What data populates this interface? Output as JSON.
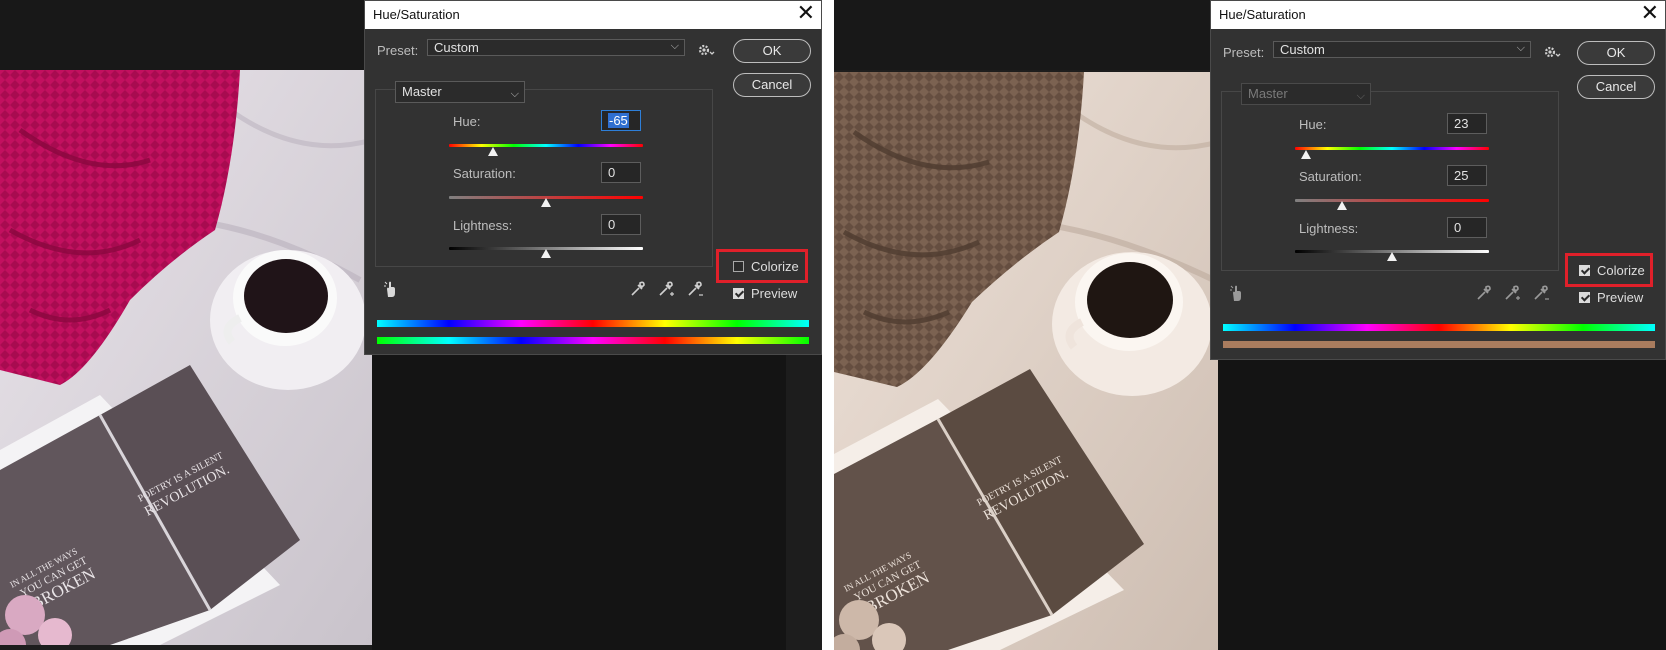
{
  "dialog_title": "Hue/Saturation",
  "close_glyph": "✕",
  "preset_label": "Preset:",
  "preset_value": "Custom",
  "channel_value": "Master",
  "ok_label": "OK",
  "cancel_label": "Cancel",
  "hue_label": "Hue:",
  "saturation_label": "Saturation:",
  "lightness_label": "Lightness:",
  "colorize_label": "Colorize",
  "preview_label": "Preview",
  "icons": {
    "gear": "gear-icon",
    "hand": "targeted-adjustment-hand-icon",
    "eyedropper": "eyedropper-icon",
    "eyedropper_add": "eyedropper-plus-icon",
    "eyedropper_subtract": "eyedropper-minus-icon"
  },
  "colors": {
    "highlight": "#e0202a",
    "dialog_bg": "#323232",
    "field_selection": "#2f6fd0",
    "sepia_bar": "#a97c5e"
  },
  "left": {
    "hue": "-65",
    "saturation": "0",
    "lightness": "0",
    "colorize_checked": false,
    "preview_checked": true,
    "channel_enabled": true,
    "hue_slider_value": -65,
    "saturation_slider_value": 0,
    "lightness_slider_value": 0
  },
  "right": {
    "hue": "23",
    "saturation": "25",
    "lightness": "0",
    "colorize_checked": true,
    "preview_checked": true,
    "channel_enabled": false,
    "hue_slider_value": 23,
    "saturation_slider_value": 25,
    "lightness_slider_value": 0
  },
  "left_book_text": {
    "line1": "POETRY IS A SILENT",
    "line2": "REVOLUTION.",
    "quote1": "IN ALL THE WAYS",
    "quote2": "YOU CAN GET",
    "quote3": "BROKEN"
  },
  "right_book_text": {
    "line1": "POETRY IS A SILENT",
    "line2": "REVOLUTION.",
    "quote1": "IN ALL THE WAYS",
    "quote2": "YOU CAN GET",
    "quote3": "BROKEN"
  }
}
